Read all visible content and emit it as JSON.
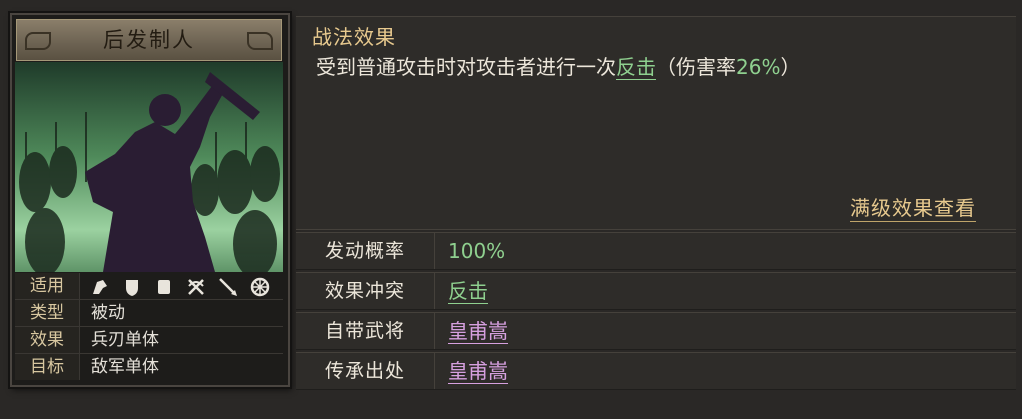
{
  "card": {
    "title": "后发制人",
    "rows": [
      {
        "key": "适用",
        "icons": [
          "cavalry-icon",
          "shield-icon",
          "shield-icon",
          "crossed-bow-icon",
          "spear-icon",
          "wheel-icon"
        ]
      },
      {
        "key": "类型",
        "value": "被动"
      },
      {
        "key": "效果",
        "value": "兵刃单体"
      },
      {
        "key": "目标",
        "value": "敌军单体"
      }
    ]
  },
  "tactic": {
    "section_title": "战法效果",
    "desc_before": "受到普通攻击时对攻击者进行一次",
    "desc_highlight": "反击",
    "desc_paren_open": "（伤害率",
    "desc_rate": "26%",
    "desc_paren_close": "）",
    "max_level_link": "满级效果查看"
  },
  "details": [
    {
      "key": "发动概率",
      "value": "100%"
    },
    {
      "key": "效果冲突",
      "value": "反击"
    },
    {
      "key": "自带武将",
      "value": "皇甫嵩"
    },
    {
      "key": "传承出处",
      "value": "皇甫嵩"
    }
  ],
  "colors": {
    "accent_gold": "#e7c98e",
    "highlight_green": "#8fd08f",
    "general_purple": "#d6a0df"
  }
}
